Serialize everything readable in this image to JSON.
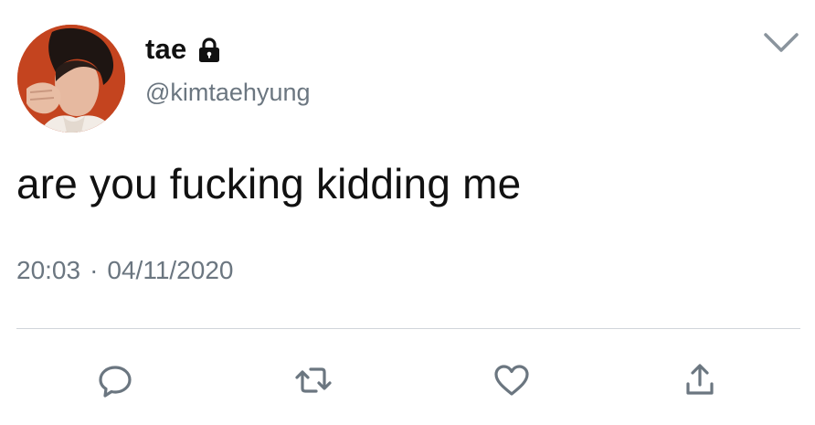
{
  "tweet": {
    "display_name": "tae",
    "handle": "@kimtaehyung",
    "text": "are you fucking kidding me",
    "time": "20:03",
    "separator": "·",
    "date": "04/11/2020"
  },
  "icons": {
    "lock": "lock-icon",
    "chevron": "chevron-down-icon",
    "reply": "reply-icon",
    "retweet": "retweet-icon",
    "like": "heart-icon",
    "share": "share-icon"
  },
  "colors": {
    "text": "#111111",
    "muted": "#6b7680",
    "icon": "#6b7680",
    "divider": "#d0d5da"
  }
}
